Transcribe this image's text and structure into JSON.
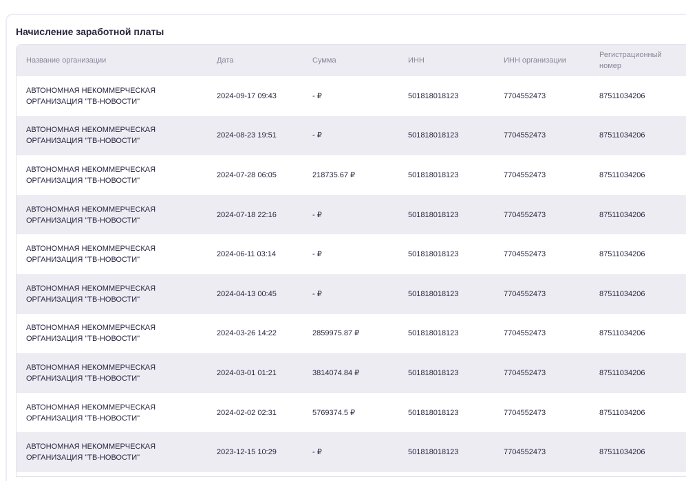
{
  "section": {
    "title": "Начисление заработной платы"
  },
  "table": {
    "headers": [
      "Название организации",
      "Дата",
      "Сумма",
      "ИНН",
      "ИНН организации",
      "Регистрационный номер"
    ],
    "rows": [
      [
        "АВТОНОМНАЯ НЕКОММЕРЧЕСКАЯ ОРГАНИЗАЦИЯ \"ТВ-НОВОСТИ\"",
        "2024-09-17 09:43",
        "- ₽",
        "501818018123",
        "7704552473",
        "87511034206"
      ],
      [
        "АВТОНОМНАЯ НЕКОММЕРЧЕСКАЯ ОРГАНИЗАЦИЯ \"ТВ-НОВОСТИ\"",
        "2024-08-23 19:51",
        "- ₽",
        "501818018123",
        "7704552473",
        "87511034206"
      ],
      [
        "АВТОНОМНАЯ НЕКОММЕРЧЕСКАЯ ОРГАНИЗАЦИЯ \"ТВ-НОВОСТИ\"",
        "2024-07-28 06:05",
        "218735.67 ₽",
        "501818018123",
        "7704552473",
        "87511034206"
      ],
      [
        "АВТОНОМНАЯ НЕКОММЕРЧЕСКАЯ ОРГАНИЗАЦИЯ \"ТВ-НОВОСТИ\"",
        "2024-07-18 22:16",
        "- ₽",
        "501818018123",
        "7704552473",
        "87511034206"
      ],
      [
        "АВТОНОМНАЯ НЕКОММЕРЧЕСКАЯ ОРГАНИЗАЦИЯ \"ТВ-НОВОСТИ\"",
        "2024-06-11 03:14",
        "- ₽",
        "501818018123",
        "7704552473",
        "87511034206"
      ],
      [
        "АВТОНОМНАЯ НЕКОММЕРЧЕСКАЯ ОРГАНИЗАЦИЯ \"ТВ-НОВОСТИ\"",
        "2024-04-13 00:45",
        "- ₽",
        "501818018123",
        "7704552473",
        "87511034206"
      ],
      [
        "АВТОНОМНАЯ НЕКОММЕРЧЕСКАЯ ОРГАНИЗАЦИЯ \"ТВ-НОВОСТИ\"",
        "2024-03-26 14:22",
        "2859975.87 ₽",
        "501818018123",
        "7704552473",
        "87511034206"
      ],
      [
        "АВТОНОМНАЯ НЕКОММЕРЧЕСКАЯ ОРГАНИЗАЦИЯ \"ТВ-НОВОСТИ\"",
        "2024-03-01 01:21",
        "3814074.84 ₽",
        "501818018123",
        "7704552473",
        "87511034206"
      ],
      [
        "АВТОНОМНАЯ НЕКОММЕРЧЕСКАЯ ОРГАНИЗАЦИЯ \"ТВ-НОВОСТИ\"",
        "2024-02-02 02:31",
        "5769374.5 ₽",
        "501818018123",
        "7704552473",
        "87511034206"
      ],
      [
        "АВТОНОМНАЯ НЕКОММЕРЧЕСКАЯ ОРГАНИЗАЦИЯ \"ТВ-НОВОСТИ\"",
        "2023-12-15 10:29",
        "- ₽",
        "501818018123",
        "7704552473",
        "87511034206"
      ]
    ]
  },
  "colors": {
    "text_primary": "#2a2440",
    "text_header": "#8a8699",
    "row_alt": "#edecf2",
    "header_bg": "#edecf3"
  }
}
